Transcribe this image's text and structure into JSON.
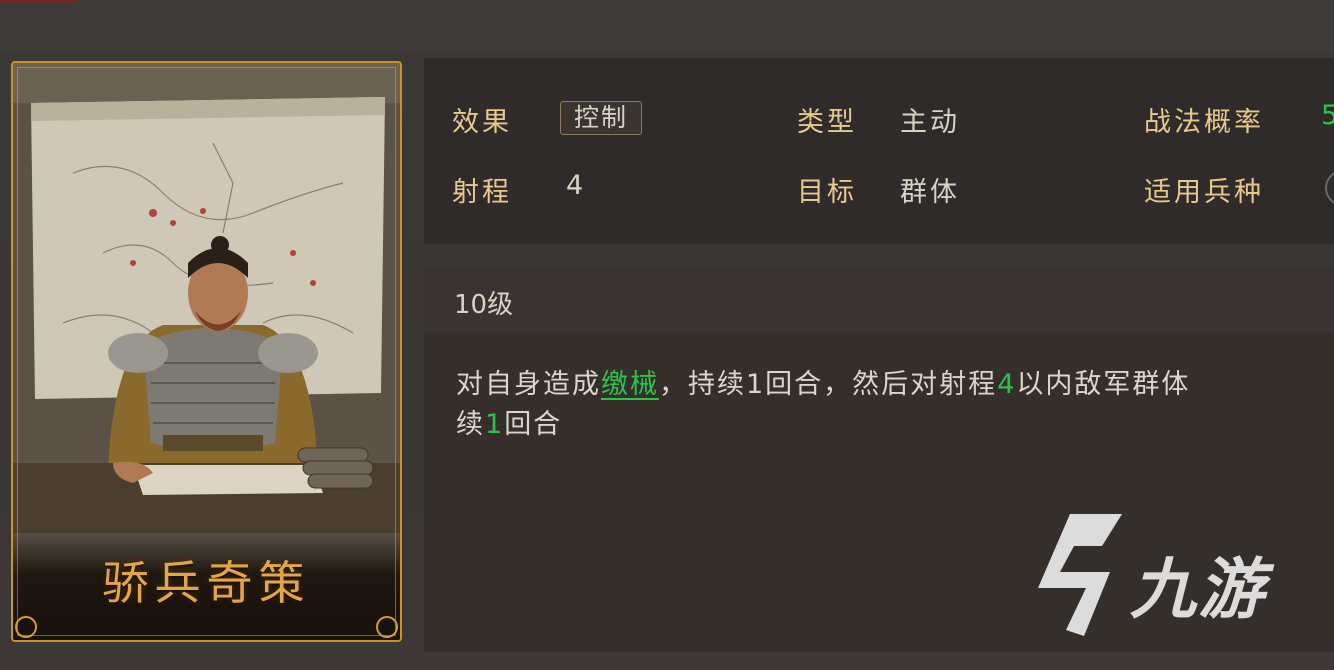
{
  "skill": {
    "name": "骄兵奇策",
    "card_image": "general-portrait"
  },
  "info": {
    "effect_label": "效果",
    "effect_value": "控制",
    "type_label": "类型",
    "type_value": "主动",
    "chance_label": "战法概率",
    "chance_value_partial": "5",
    "range_label": "射程",
    "range_value": "4",
    "target_label": "目标",
    "target_value": "群体",
    "troop_label": "适用兵种"
  },
  "description": {
    "level": "10级",
    "seg1": "对自身造成",
    "keyword": "缴械",
    "seg2": "，持续1回合，然后对射程",
    "range_num": "4",
    "seg3": "以内敌军群体",
    "line2_a": "续",
    "line2_num": "1",
    "line2_b": "回合"
  },
  "watermark": {
    "text": "九游"
  },
  "colors": {
    "accent_gold": "#c6961f",
    "label_gold": "#e7c98e",
    "highlight_green": "#2fc24a"
  }
}
